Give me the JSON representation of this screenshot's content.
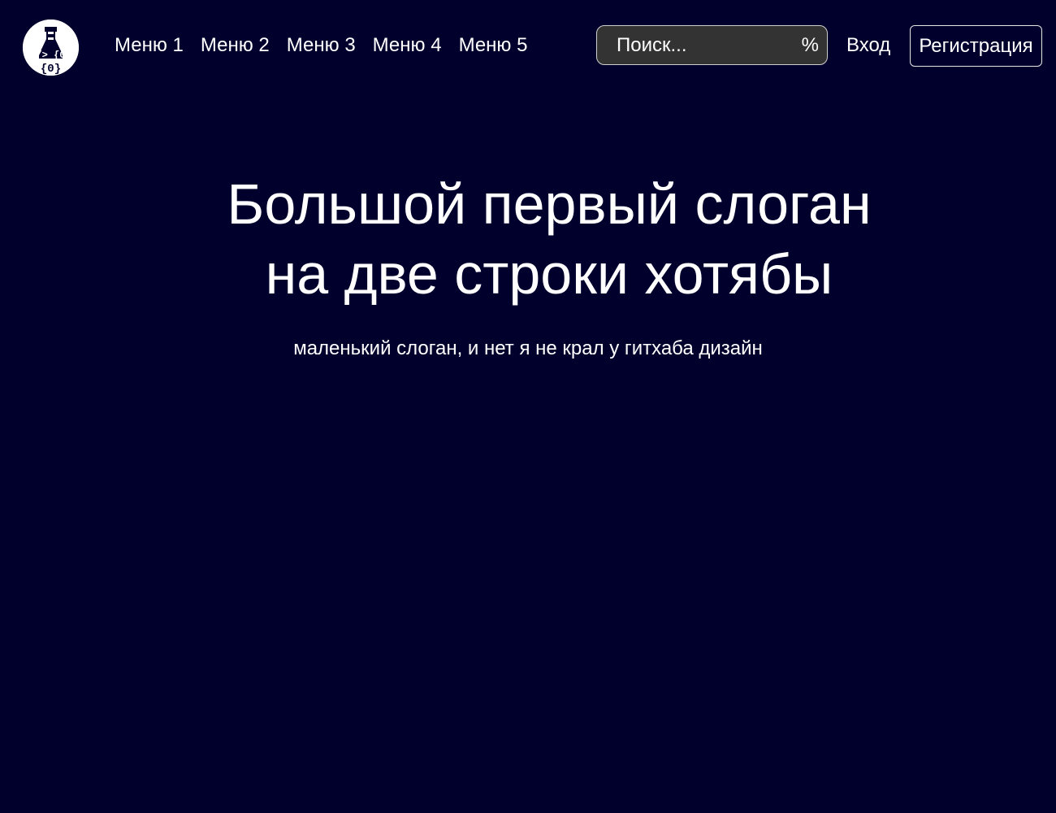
{
  "header": {
    "logo_icon": "flask-code-logo-icon",
    "logo_text": "</> {0}",
    "nav": [
      {
        "label": "Меню 1"
      },
      {
        "label": "Меню 2"
      },
      {
        "label": "Меню 3"
      },
      {
        "label": "Меню 4"
      },
      {
        "label": "Меню 5"
      }
    ],
    "search": {
      "placeholder": "Поиск...",
      "value": "",
      "shortcut": "%"
    },
    "signin_label": "Вход",
    "signup_label": "Регистрация"
  },
  "hero": {
    "title_line1": "Большой первый слоган",
    "title_line2": "на две строки хотябы",
    "subtitle": "маленький слоган, и нет я не крал у гитхаба дизайн"
  },
  "colors": {
    "background": "#01002d",
    "text": "#ffffff",
    "search_background": "#333333",
    "logo_background": "#ffffff",
    "logo_foreground": "#01002d"
  }
}
